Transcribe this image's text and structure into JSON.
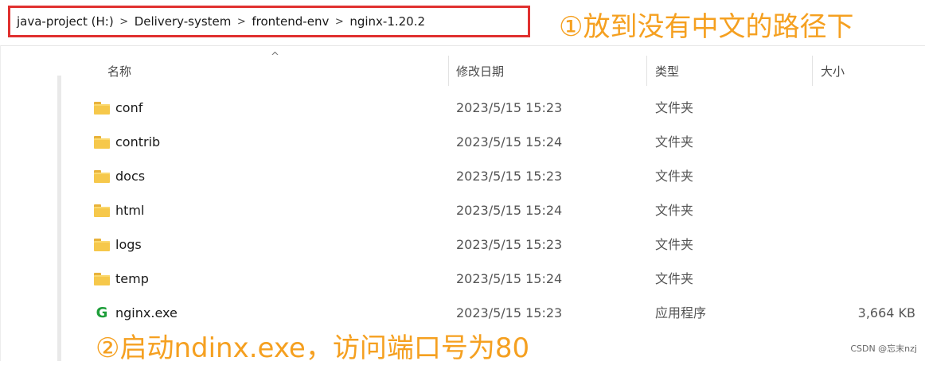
{
  "breadcrumb": {
    "items": [
      "java-project (H:)",
      "Delivery-system",
      "frontend-env",
      "nginx-1.20.2"
    ],
    "separator": ">"
  },
  "annotations": {
    "top": "①放到没有中文的路径下",
    "bottom": "②启动ndinx.exe，访问端口号为80",
    "color": "#f5a020"
  },
  "columns": {
    "name": "名称",
    "modified": "修改日期",
    "type": "类型",
    "size": "大小"
  },
  "files": [
    {
      "name": "conf",
      "modified": "2023/5/15 15:23",
      "type": "文件夹",
      "size": "",
      "icon": "folder-icon"
    },
    {
      "name": "contrib",
      "modified": "2023/5/15 15:24",
      "type": "文件夹",
      "size": "",
      "icon": "folder-icon"
    },
    {
      "name": "docs",
      "modified": "2023/5/15 15:23",
      "type": "文件夹",
      "size": "",
      "icon": "folder-icon"
    },
    {
      "name": "html",
      "modified": "2023/5/15 15:24",
      "type": "文件夹",
      "size": "",
      "icon": "folder-icon"
    },
    {
      "name": "logs",
      "modified": "2023/5/15 15:23",
      "type": "文件夹",
      "size": "",
      "icon": "folder-icon"
    },
    {
      "name": "temp",
      "modified": "2023/5/15 15:24",
      "type": "文件夹",
      "size": "",
      "icon": "folder-icon"
    },
    {
      "name": "nginx.exe",
      "modified": "2023/5/15 15:23",
      "type": "应用程序",
      "size": "3,664 KB",
      "icon": "nginx-exe-icon"
    }
  ],
  "watermark": "CSDN @忘末nzj",
  "colors": {
    "highlight_border": "#e0302f",
    "folder": "#f6c84b",
    "exe_icon": "#1e9e3a"
  }
}
